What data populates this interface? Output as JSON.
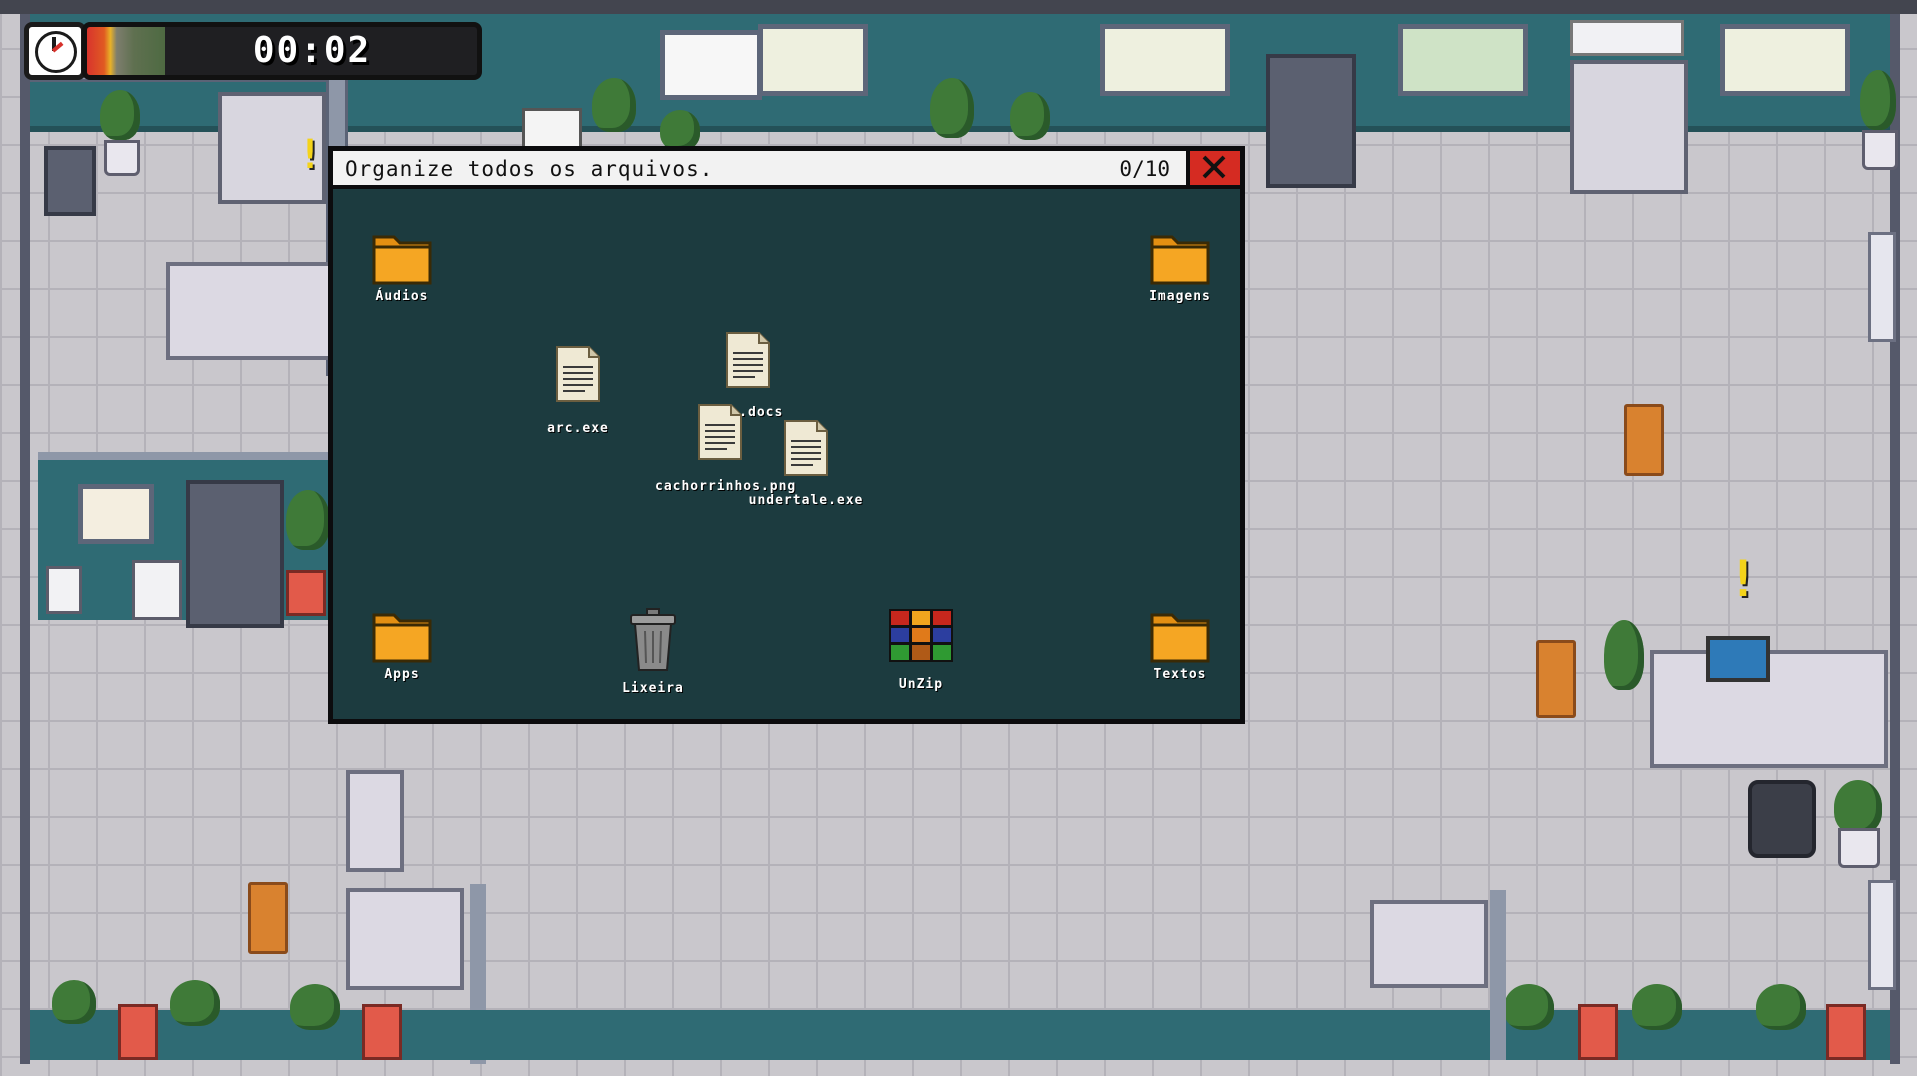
{
  "hud": {
    "timer": "00:02",
    "time_bar_fill": 0.2,
    "clock_icon": "clock-icon"
  },
  "dialog": {
    "title": "Organize todos os arquivos.",
    "progress": "0/10",
    "close_icon": "close-icon",
    "colors": {
      "background": "#1c3b3f",
      "close": "#d52b22",
      "folder": "#f5a623"
    }
  },
  "folders": {
    "audios": "Áudios",
    "imagens": "Imagens",
    "apps": "Apps",
    "textos": "Textos"
  },
  "files": {
    "arc": "arc.exe",
    "diro": "iro.docs",
    "cachorrinhos": "cachorrinhos.png",
    "undertale": "undertale.exe"
  },
  "tools": {
    "lixeira": "Lixeira",
    "unzip": "UnZip"
  }
}
